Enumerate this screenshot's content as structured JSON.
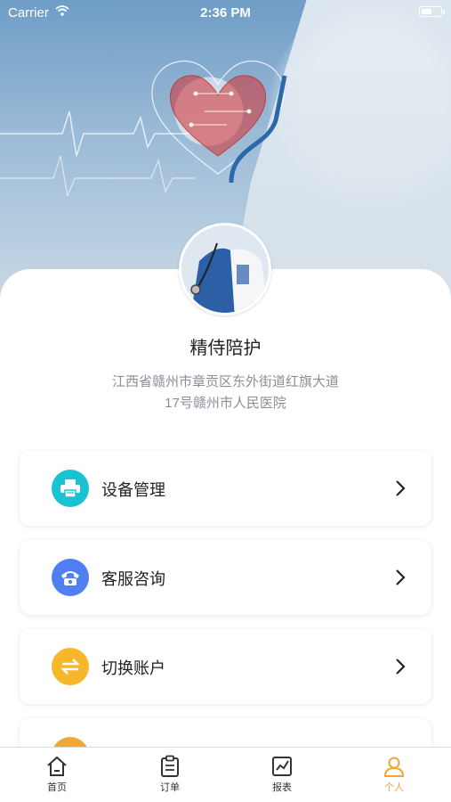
{
  "status_bar": {
    "carrier": "Carrier",
    "time": "2:36 PM",
    "battery_level": 0.55
  },
  "profile": {
    "name": "精侍陪护",
    "address": "江西省赣州市章贡区东外街道红旗大道17号赣州市人民医院"
  },
  "menu": {
    "items": [
      {
        "label": "设备管理",
        "icon": "printer-icon",
        "color": "#19c3d3"
      },
      {
        "label": "客服咨询",
        "icon": "phone-icon",
        "color": "#4f7ff2"
      },
      {
        "label": "切换账户",
        "icon": "swap-icon",
        "color": "#f7b72a"
      },
      {
        "label": "",
        "icon": "partial-icon",
        "color": "#f0a733"
      }
    ]
  },
  "tabbar": {
    "tabs": [
      {
        "label": "首页",
        "icon": "home-icon"
      },
      {
        "label": "订单",
        "icon": "clipboard-icon"
      },
      {
        "label": "报表",
        "icon": "chart-icon"
      },
      {
        "label": "个人",
        "icon": "person-icon",
        "active": true
      }
    ],
    "active_color": "#f0a733"
  }
}
